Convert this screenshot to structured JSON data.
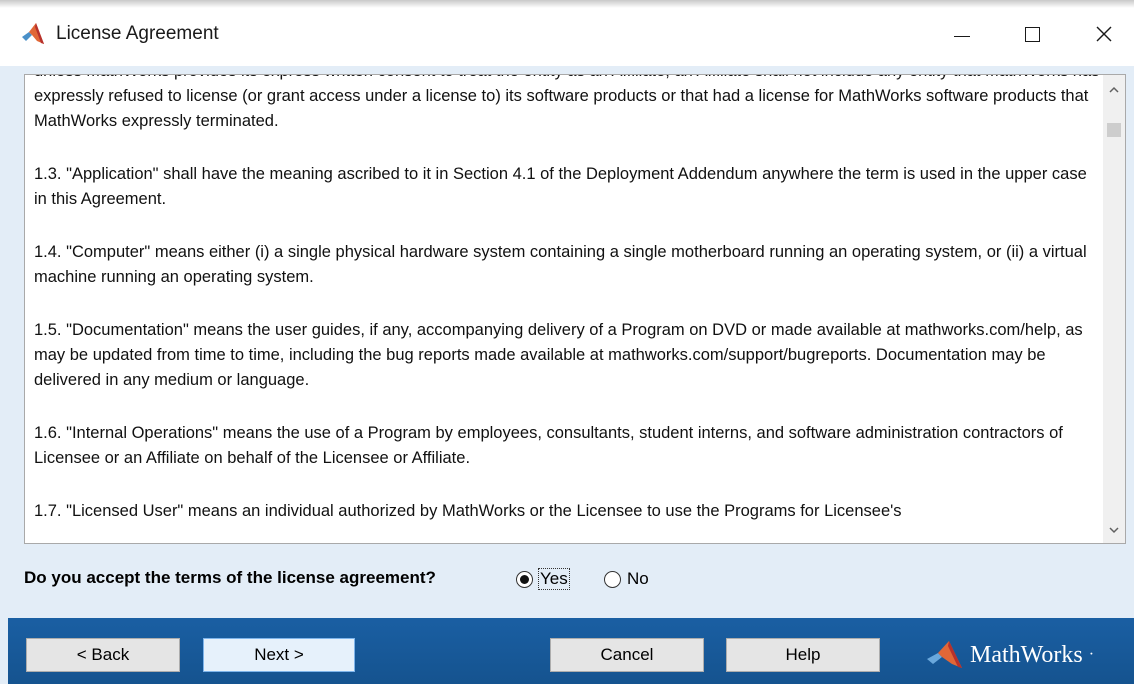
{
  "window": {
    "title": "License Agreement",
    "controls": {
      "minimize": "—",
      "maximize": "",
      "close": "✕"
    }
  },
  "agreement": {
    "paragraphs": [
      "unless MathWorks provides its express written consent to treat the entity as an Affiliate, an Affiliate shall not include any entity that MathWorks has expressly refused to license (or grant access under a license to) its software products or that had a license for MathWorks software products that MathWorks expressly terminated.",
      "1.3. \"Application\" shall have the meaning ascribed to it in Section 4.1 of the Deployment Addendum anywhere the term is used in the upper case in this Agreement.",
      "1.4. \"Computer\" means either (i) a single physical hardware system containing a single motherboard running an operating system, or (ii) a virtual machine running an operating system.",
      "1.5. \"Documentation\" means the user guides, if any, accompanying delivery of a Program on DVD or made available at mathworks.com/help, as may be updated from time to time, including the bug reports made available at mathworks.com/support/bugreports. Documentation may be delivered in any medium or language.",
      "1.6. \"Internal Operations\" means the use of a Program by employees, consultants, student interns, and software administration contractors of Licensee or an Affiliate on behalf of the Licensee or Affiliate.",
      "1.7. \"Licensed User\" means an individual authorized by MathWorks or the Licensee to use the Programs for Licensee's"
    ],
    "scroll_up": "^",
    "scroll_down": "v"
  },
  "accept": {
    "question": "Do you accept the terms of the license agreement?",
    "yes_label": "Yes",
    "no_label": "No",
    "selected": "Yes"
  },
  "buttons": {
    "back": "< Back",
    "next": "Next >",
    "cancel": "Cancel",
    "help": "Help"
  },
  "brand": {
    "name": "MathWorks",
    "mark": "·"
  },
  "colors": {
    "bottom_bar": "#1a5fa3",
    "background": "#e3edf7",
    "logo_orange": "#e16737",
    "logo_red": "#b7312c"
  }
}
